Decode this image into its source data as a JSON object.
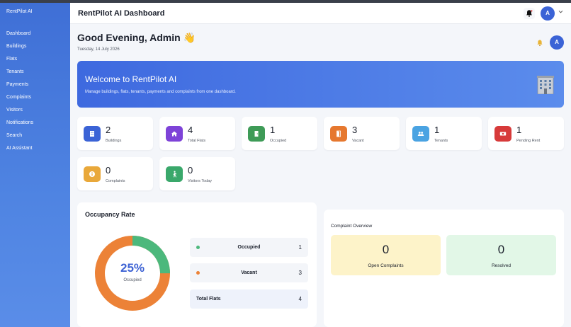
{
  "app": {
    "brand": "RentPilot AI"
  },
  "sidebar": {
    "items": [
      {
        "label": "Dashboard"
      },
      {
        "label": "Buildings"
      },
      {
        "label": "Flats"
      },
      {
        "label": "Tenants"
      },
      {
        "label": "Payments"
      },
      {
        "label": "Complaints"
      },
      {
        "label": "Visitors"
      },
      {
        "label": "Notifications"
      },
      {
        "label": "Search"
      },
      {
        "label": "AI Assistant"
      }
    ]
  },
  "header": {
    "title": "RentPilot AI Dashboard",
    "avatar_initial": "A"
  },
  "greeting": {
    "text": "Good Evening, Admin 👋",
    "date": "Tuesday, 14 July 2026",
    "avatar_initial": "A"
  },
  "welcome": {
    "title": "Welcome to RentPilot AI",
    "subtitle": "Manage buildings, flats, tenants, payments and complaints from one dashboard."
  },
  "stats": [
    {
      "value": "2",
      "label": "Buildings",
      "icon": "building-icon",
      "color": "#3b63d6"
    },
    {
      "value": "4",
      "label": "Total Flats",
      "icon": "home-icon",
      "color": "#7e43d8"
    },
    {
      "value": "1",
      "label": "Occupied",
      "icon": "door-icon",
      "color": "#3e9b57"
    },
    {
      "value": "3",
      "label": "Vacant",
      "icon": "door-open-icon",
      "color": "#e6782f"
    },
    {
      "value": "1",
      "label": "Tenants",
      "icon": "users-icon",
      "color": "#4aa3e2"
    },
    {
      "value": "1",
      "label": "Pending Rent",
      "icon": "money-icon",
      "color": "#d73a3a"
    },
    {
      "value": "0",
      "label": "Complaints",
      "icon": "info-icon",
      "color": "#e9a83a"
    },
    {
      "value": "0",
      "label": "Visitors Today",
      "icon": "walking-person-icon",
      "color": "#3aa86b"
    }
  ],
  "occupancy": {
    "title": "Occupancy Rate",
    "percent_text": "25%",
    "percent_label": "Occupied",
    "occupied_fraction": 0.25,
    "colors": {
      "occupied": "#4cb87c",
      "vacant": "#ec8237"
    },
    "legend": [
      {
        "name": "Occupied",
        "value": "1",
        "color": "#4cb87c"
      },
      {
        "name": "Vacant",
        "value": "3",
        "color": "#ec8237"
      }
    ],
    "total": {
      "name": "Total Flats",
      "value": "4"
    }
  },
  "complaints": {
    "title": "Complaint Overview",
    "open": {
      "value": "0",
      "label": "Open Complaints",
      "color": "#fdf3c9"
    },
    "resolved": {
      "value": "0",
      "label": "Resolved",
      "color": "#e2f7e7"
    }
  }
}
